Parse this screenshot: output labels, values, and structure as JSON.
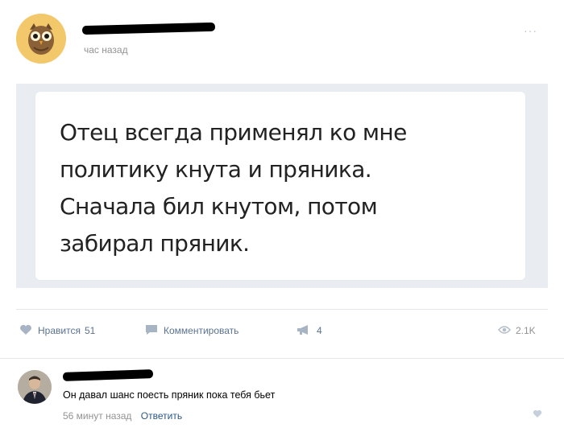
{
  "post": {
    "author_name": "",
    "time": "час назад",
    "menu_icon": "more-dots-icon",
    "quote": {
      "lines": [
        "Отец всегда применял ко мне",
        "политику кнута и пряника.",
        "Сначала бил кнутом, потом",
        "забирал пряник."
      ]
    },
    "actions": {
      "like_label": "Нравится",
      "like_count": "51",
      "comment_label": "Комментировать",
      "share_count": "4",
      "views": "2.1K"
    }
  },
  "comment": {
    "author_name": "",
    "text": "Он давал шанс поесть пряник пока тебя бьет",
    "time": "56 минут назад",
    "reply_label": "Ответить"
  },
  "colors": {
    "link": "#2a5885",
    "muted": "#939393",
    "frame": "#e9edf1"
  }
}
